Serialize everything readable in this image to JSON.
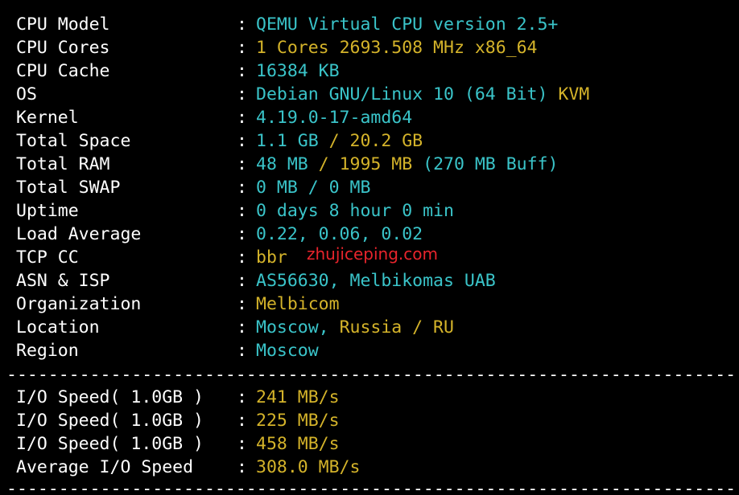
{
  "system_info": {
    "cpu_model": {
      "label": "CPU Model",
      "value": "QEMU Virtual CPU version 2.5+"
    },
    "cpu_cores": {
      "label": "CPU Cores",
      "count": "1 Cores",
      "freq": "2693.508 MHz x86_64"
    },
    "cpu_cache": {
      "label": "CPU Cache",
      "value": "16384 KB"
    },
    "os": {
      "label": "OS",
      "value": "Debian GNU/Linux 10 (64 Bit)",
      "virt": "KVM"
    },
    "kernel": {
      "label": "Kernel",
      "value": "4.19.0-17-amd64"
    },
    "total_space": {
      "label": "Total Space",
      "used": "1.1 GB",
      "sep": " / ",
      "total": "20.2 GB"
    },
    "total_ram": {
      "label": "Total RAM",
      "used": "48 MB",
      "sep": " / ",
      "total": "1995 MB",
      "buff": "(270 MB Buff)"
    },
    "total_swap": {
      "label": "Total SWAP",
      "value": "0 MB / 0 MB"
    },
    "uptime": {
      "label": "Uptime",
      "value": "0 days 8 hour 0 min"
    },
    "load_average": {
      "label": "Load Average",
      "value": "0.22, 0.06, 0.02"
    },
    "tcp_cc": {
      "label": "TCP CC",
      "value": "bbr"
    },
    "asn_isp": {
      "label": "ASN & ISP",
      "value": "AS56630, Melbikomas UAB"
    },
    "organization": {
      "label": "Organization",
      "value": "Melbicom"
    },
    "location": {
      "label": "Location",
      "city": "Moscow,",
      "country": "Russia / RU"
    },
    "region": {
      "label": "Region",
      "value": "Moscow"
    }
  },
  "colon": ":",
  "divider": "----------------------------------------------------------------------------------------------------------------",
  "io_speed": {
    "runs": [
      {
        "label": "I/O Speed( 1.0GB )",
        "value": "241 MB/s"
      },
      {
        "label": "I/O Speed( 1.0GB )",
        "value": "225 MB/s"
      },
      {
        "label": "I/O Speed( 1.0GB )",
        "value": "458 MB/s"
      }
    ],
    "average": {
      "label": "Average I/O Speed",
      "value": "308.0 MB/s"
    }
  },
  "watermark": "zhujiceping.com",
  "colors": {
    "background": "#000000",
    "text": "#ffffff",
    "cyan": "#3ac4c9",
    "yellow": "#d4b32a",
    "watermark": "#e8242c"
  }
}
